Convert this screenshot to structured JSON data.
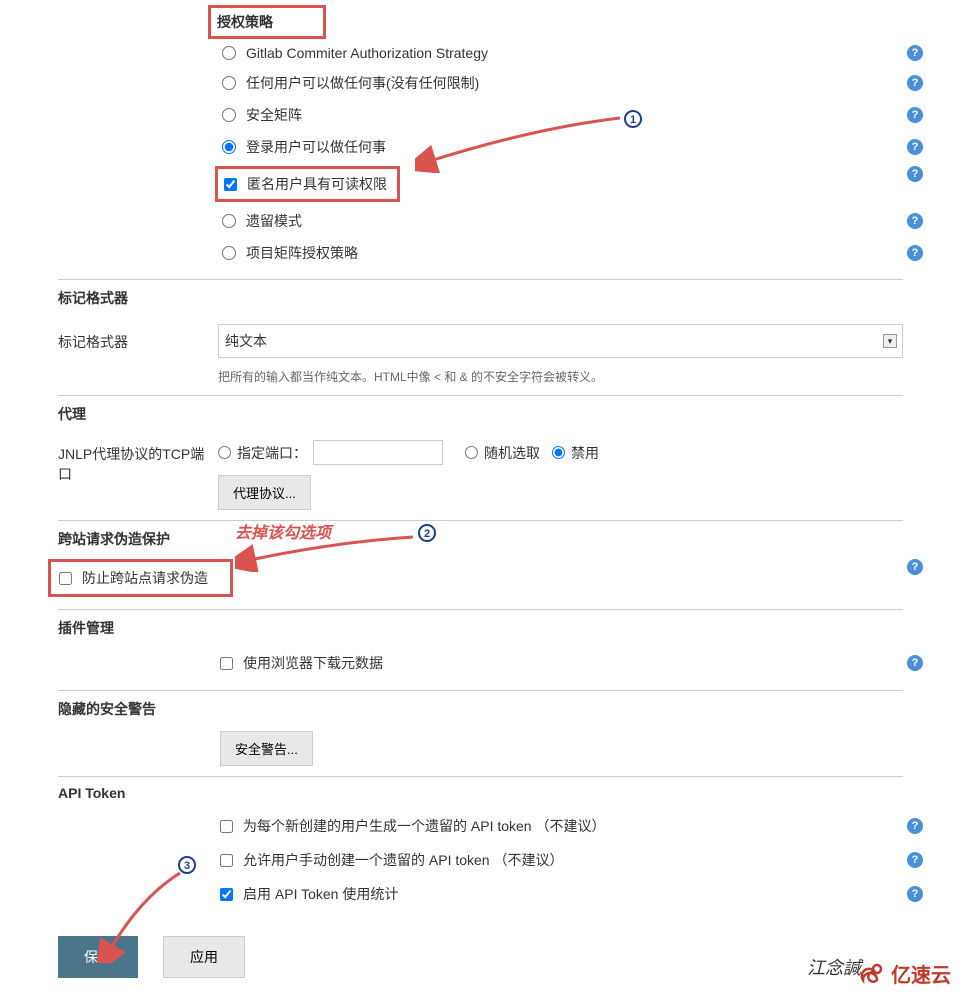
{
  "auth": {
    "title": "授权策略",
    "options": [
      "Gitlab Commiter Authorization Strategy",
      "任何用户可以做任何事(没有任何限制)",
      "安全矩阵",
      "登录用户可以做任何事",
      "遗留模式",
      "项目矩阵授权策略"
    ],
    "selected": 3,
    "anon_checkbox": "匿名用户具有可读权限"
  },
  "marker": {
    "section": "标记格式器",
    "label": "标记格式器",
    "value": "纯文本",
    "hint": "把所有的输入都当作纯文本。HTML中像 < 和 & 的不安全字符会被转义。"
  },
  "proxy": {
    "section": "代理",
    "label": "JNLP代理协议的TCP端口",
    "specify": "指定端口：",
    "random": "随机选取",
    "disable": "禁用",
    "button": "代理协议..."
  },
  "csrf": {
    "section": "跨站请求伪造保护",
    "checkbox": "防止跨站点请求伪造"
  },
  "plugin": {
    "section": "插件管理",
    "checkbox": "使用浏览器下载元数据"
  },
  "hidden_warn": {
    "section": "隐藏的安全警告",
    "button": "安全警告..."
  },
  "api_token": {
    "section": "API Token",
    "opt1": "为每个新创建的用户生成一个遗留的 API token  （不建议）",
    "opt2": "允许用户手动创建一个遗留的 API token  （不建议）",
    "opt3": "启用 API Token 使用统计"
  },
  "buttons": {
    "save": "保存",
    "apply": "应用"
  },
  "annotations": {
    "note1": "去掉该勾选项",
    "badge1": "1",
    "badge2": "2",
    "badge3": "3"
  },
  "watermark": {
    "text": "江念諴",
    "logo": "亿速云"
  }
}
